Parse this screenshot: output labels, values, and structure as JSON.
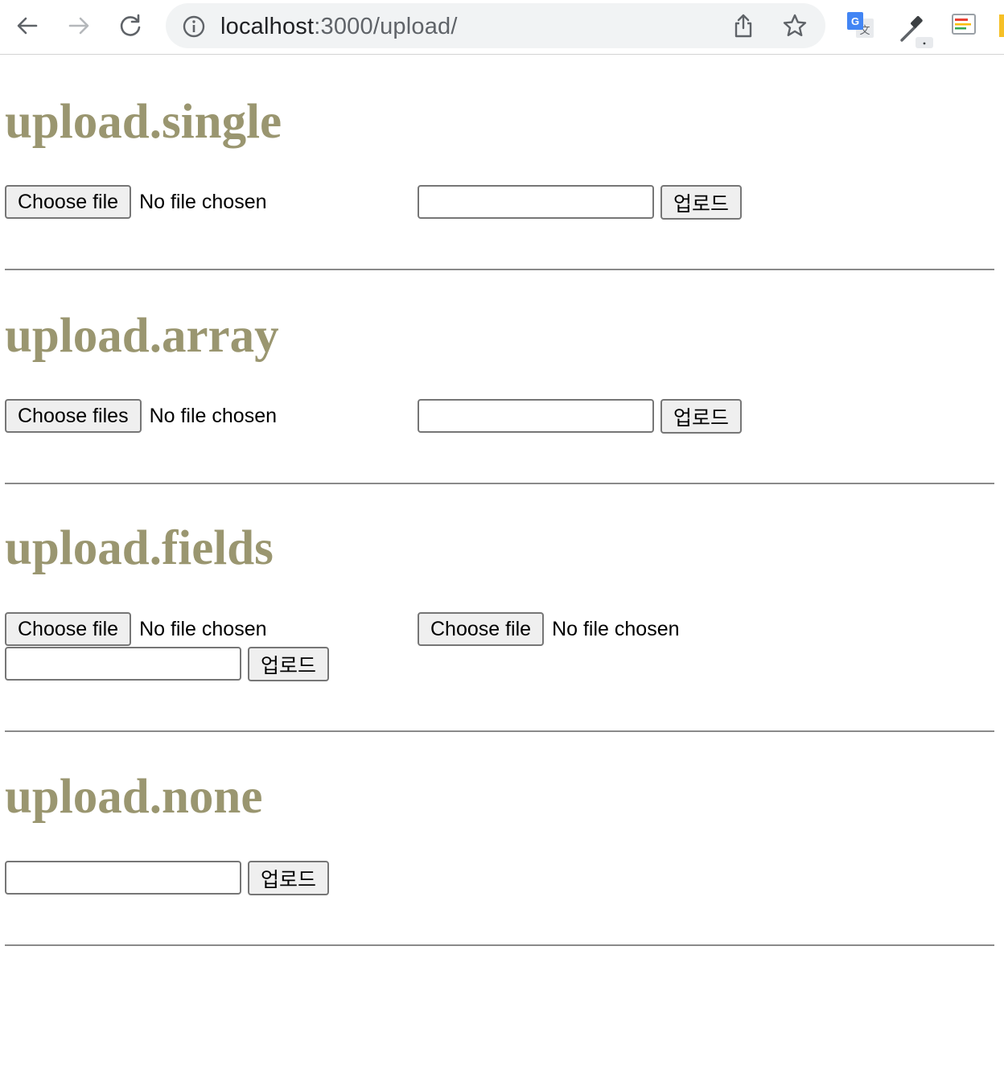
{
  "browser": {
    "url_host": "localhost",
    "url_path": ":3000/upload/",
    "icons": [
      "back-arrow-icon",
      "forward-arrow-icon",
      "reload-icon",
      "site-info-icon",
      "share-icon",
      "bookmark-star-icon",
      "google-translate-icon",
      "eyedropper-icon",
      "reader-extension-icon"
    ]
  },
  "sections": [
    {
      "title": "upload.single",
      "file_inputs": [
        {
          "button": "Choose file",
          "status": "No file chosen"
        }
      ],
      "text_value": "",
      "submit": "업로드"
    },
    {
      "title": "upload.array",
      "file_inputs": [
        {
          "button": "Choose files",
          "status": "No file chosen"
        }
      ],
      "text_value": "",
      "submit": "업로드"
    },
    {
      "title": "upload.fields",
      "file_inputs": [
        {
          "button": "Choose file",
          "status": "No file chosen"
        },
        {
          "button": "Choose file",
          "status": "No file chosen"
        }
      ],
      "text_value": "",
      "submit": "업로드"
    },
    {
      "title": "upload.none",
      "file_inputs": [],
      "text_value": "",
      "submit": "업로드"
    }
  ],
  "colors": {
    "heading": "#9a9670",
    "button_bg": "#efefef",
    "border": "#767676",
    "divider": "#8a8a8a"
  }
}
